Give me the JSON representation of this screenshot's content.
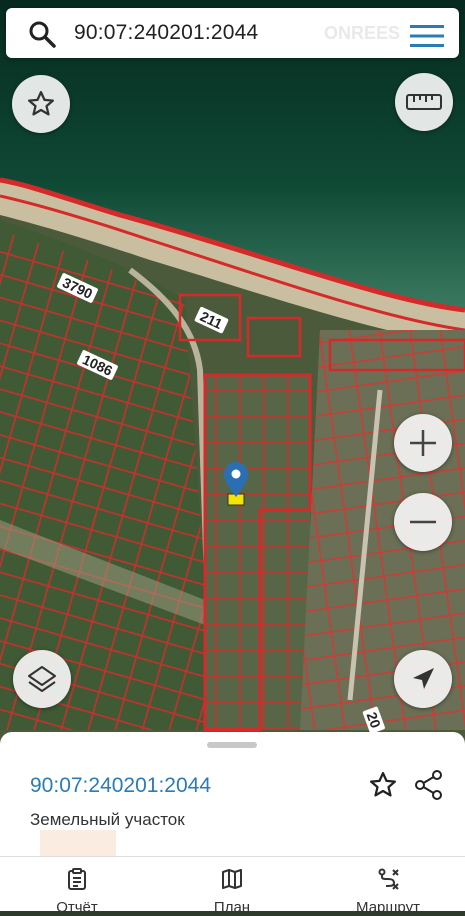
{
  "search": {
    "query": "90:07:240201:2044",
    "watermark": "ONREES"
  },
  "map": {
    "labels": [
      "3790",
      "211",
      "1086",
      "20"
    ],
    "controls": {
      "favorite": "star-icon",
      "ruler": "ruler-icon",
      "zoom_in": "+",
      "zoom_out": "−",
      "layers": "layers-icon",
      "locate": "navigation-arrow-icon"
    },
    "colors": {
      "sea": "#0e3a2a",
      "parcel_border": "#d62a2a",
      "pin": "#2a6fb3",
      "marker": "#f5e400"
    }
  },
  "sheet": {
    "cadastral_number": "90:07:240201:2044",
    "object_type": "Земельный участок"
  },
  "tabs": [
    {
      "label": "Отчёт",
      "icon": "clipboard-icon"
    },
    {
      "label": "План",
      "icon": "map-icon"
    },
    {
      "label": "Маршрут",
      "icon": "route-icon"
    }
  ]
}
